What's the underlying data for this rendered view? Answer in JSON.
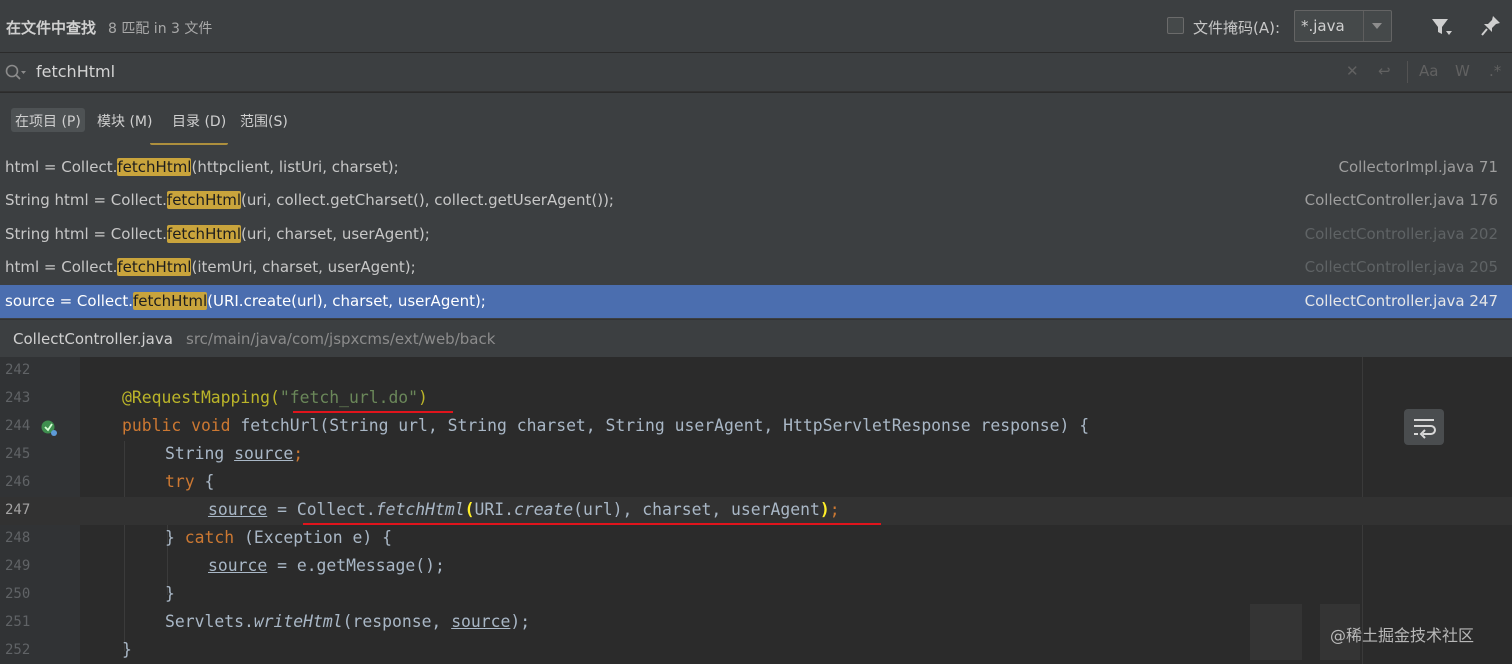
{
  "header": {
    "title": "在文件中查找",
    "count": "8 匹配 in 3 文件",
    "file_mask_label": "文件掩码(A):",
    "file_mask_value": "*.java"
  },
  "search": {
    "query": "fetchHtml",
    "tools": [
      "Aa",
      "W"
    ]
  },
  "scope_tabs": [
    {
      "label": "在项目 (P)",
      "active": true
    },
    {
      "label": "模块 (M)",
      "active": false
    },
    {
      "label": "目录 (D)",
      "active": false
    },
    {
      "label": "范围(S)",
      "active": false
    }
  ],
  "results": [
    {
      "prefix": "html = Collect.",
      "match": "fetchHtml",
      "suffix": "(httpclient, listUri, charset);",
      "location": "CollectorImpl.java 71",
      "dim": false,
      "selected": false
    },
    {
      "prefix": "String html = Collect.",
      "match": "fetchHtml",
      "suffix": "(uri, collect.getCharset(), collect.getUserAgent());",
      "location": "CollectController.java 176",
      "dim": false,
      "selected": false
    },
    {
      "prefix": "String html = Collect.",
      "match": "fetchHtml",
      "suffix": "(uri, charset, userAgent);",
      "location": "CollectController.java 202",
      "dim": true,
      "selected": false
    },
    {
      "prefix": "html = Collect.",
      "match": "fetchHtml",
      "suffix": "(itemUri, charset, userAgent);",
      "location": "CollectController.java 205",
      "dim": true,
      "selected": false
    },
    {
      "prefix": "source = Collect.",
      "match": "fetchHtml",
      "suffix": "(URI.create(url), charset, userAgent);",
      "location": "CollectController.java 247",
      "dim": false,
      "selected": true
    }
  ],
  "path": {
    "file": "CollectController.java",
    "dir": "src/main/java/com/jspxcms/ext/web/back"
  },
  "editor": {
    "line_numbers": [
      "242",
      "243",
      "244",
      "245",
      "246",
      "247",
      "248",
      "249",
      "250",
      "251",
      "252"
    ],
    "current_line": "247",
    "lines": {
      "l243_ann": "@RequestMapping(",
      "l243_str": "\"fetch_url.do\"",
      "l243_end": ")",
      "l244_kw": "public void ",
      "l244_rest": "fetchUrl(String url, String charset, String userAgent, HttpServletResponse response) {",
      "l245_a": "String ",
      "l245_b": "source",
      "l245_c": ";",
      "l246_kw": "try",
      "l246_rest": " {",
      "l247_a": "source",
      "l247_b": " = Collect.",
      "l247_c": "fetchHtml",
      "l247_d": "(",
      "l247_e": "URI.",
      "l247_f": "create",
      "l247_g": "(url), charset, userAgent",
      "l247_h": ")",
      "l247_i": ";",
      "l248_a": "} ",
      "l248_kw": "catch",
      "l248_rest": " (Exception e) {",
      "l249_a": "source",
      "l249_b": " = e.getMessage();",
      "l250": "}",
      "l251_a": "Servlets.",
      "l251_b": "writeHtml",
      "l251_c": "(response, ",
      "l251_d": "source",
      "l251_e": ");",
      "l252": "}"
    }
  },
  "watermark": "@稀土掘金技术社区",
  "colors": {
    "selection": "#4b6eaf",
    "match_highlight": "#c9a43c",
    "red_underline": "#e0141c"
  }
}
